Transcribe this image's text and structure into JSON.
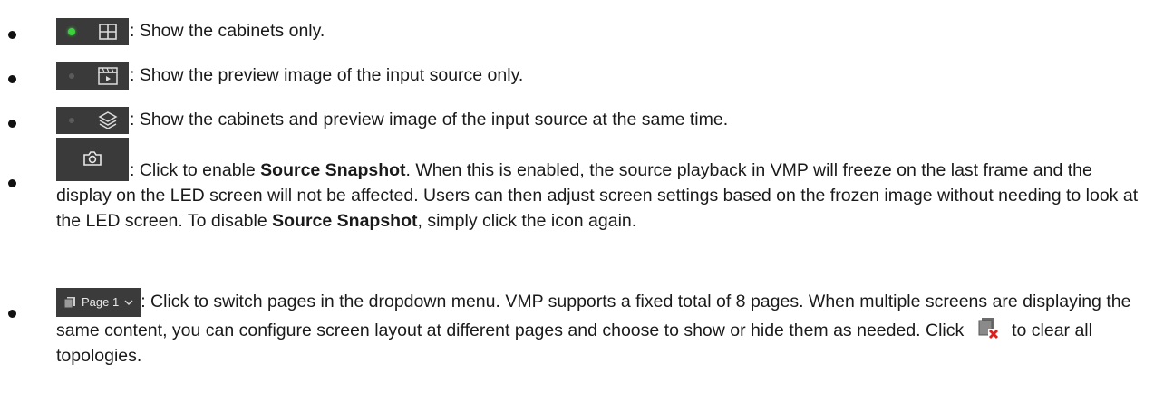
{
  "items": [
    {
      "icon": "cabinets-view-icon",
      "text": ": Show the cabinets only."
    },
    {
      "icon": "preview-view-icon",
      "text": ": Show the preview image of the input source only."
    },
    {
      "icon": "layered-view-icon",
      "text": ": Show the cabinets and preview image of the input source at the same time."
    },
    {
      "icon": "camera-icon",
      "t1": ": Click to enable ",
      "b1": "Source Snapshot",
      "t2": ". When this is enabled, the source playback in VMP will freeze on the last frame and the display on the LED screen will not be affected. Users can then adjust screen settings based on the frozen image without needing to look at the LED screen. To disable ",
      "b2": "Source Snapshot",
      "t3": ", simply click the icon again."
    },
    {
      "page_label": "Page 1",
      "t1": ": Click to switch pages in the dropdown menu. VMP supports a fixed total of 8 pages. When multiple screens are displaying the same content, you can configure screen layout at different pages and choose to show or hide them as needed. Click ",
      "t2": " to clear all topologies."
    }
  ],
  "colors": {
    "icon_bg": "#3a3a3a",
    "active_dot": "#3cd43c",
    "inactive_dot": "#5a5a5a",
    "clear_x": "#e01b1b"
  }
}
